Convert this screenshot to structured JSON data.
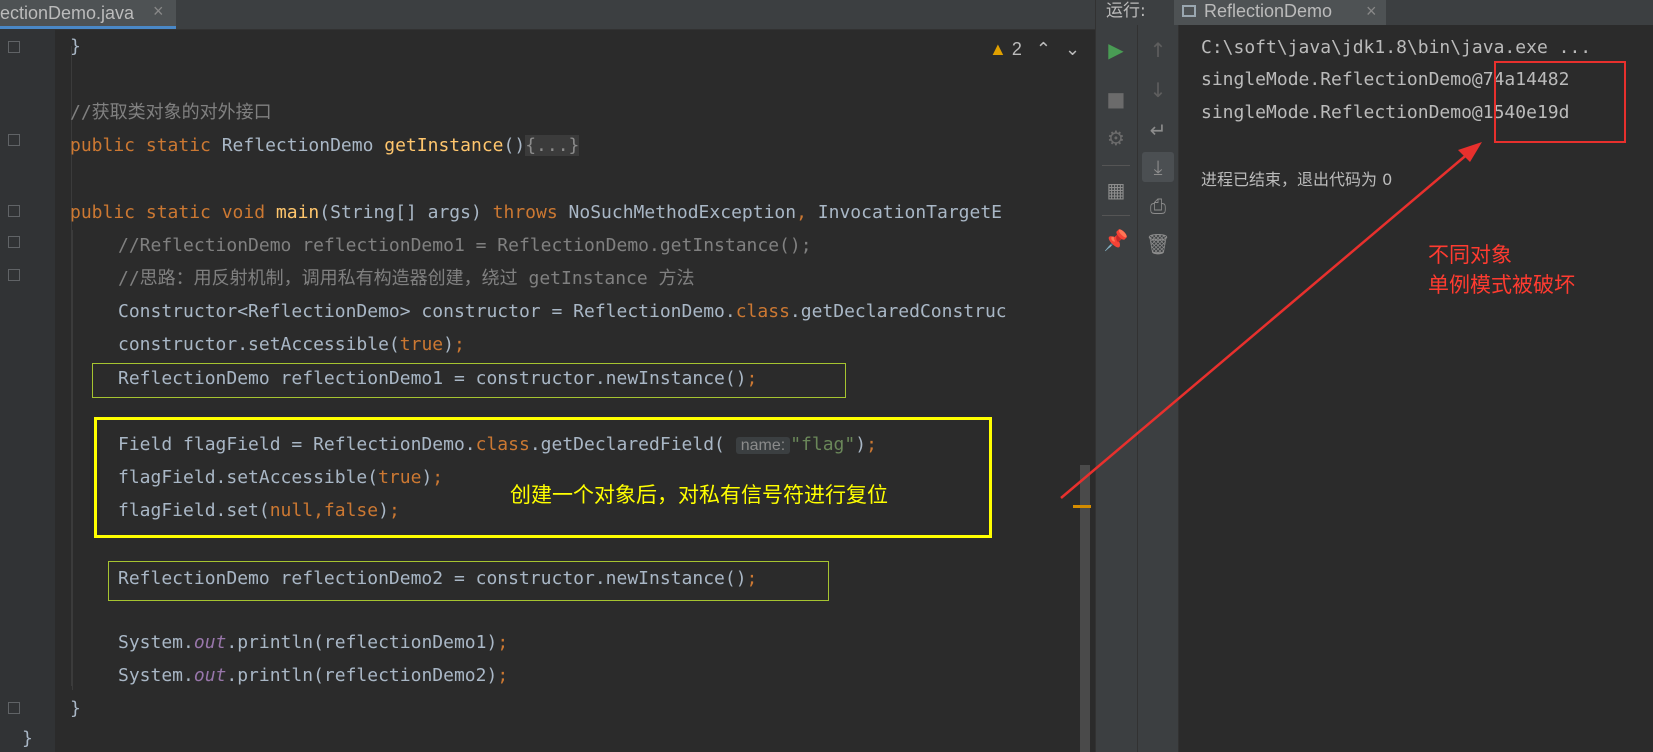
{
  "editor": {
    "tab_title": "ectionDemo.java",
    "tab_close": "×",
    "warning_count": "2",
    "lines": [
      "}",
      "//获取类对象的对外接口",
      "public static ReflectionDemo getInstance(){...}",
      "public static void main(String[] args) throws NoSuchMethodException, InvocationTargetE",
      "//ReflectionDemo reflectionDemo1 = ReflectionDemo.getInstance();",
      "//思路：用反射机制，调用私有构造器创建，绕过 getInstance 方法",
      "Constructor<ReflectionDemo> constructor = ReflectionDemo.class.getDeclaredConstruc",
      "constructor.setAccessible(true);",
      "ReflectionDemo reflectionDemo1 = constructor.newInstance();",
      "Field flagField = ReflectionDemo.class.getDeclaredField( name: \"flag\");",
      "flagField.setAccessible(true);",
      "flagField.set(null,false);",
      "ReflectionDemo reflectionDemo2 = constructor.newInstance();",
      "System.out.println(reflectionDemo1);",
      "System.out.println(reflectionDemo2);",
      "}",
      "}"
    ],
    "param_hint": "name:",
    "annotation": "创建一个对象后，对私有信号符进行复位"
  },
  "run": {
    "label": "运行:",
    "tab_title": "ReflectionDemo",
    "tab_close": "×",
    "output": [
      "C:\\soft\\java\\jdk1.8\\bin\\java.exe ...",
      "singleMode.ReflectionDemo@74a14482",
      "singleMode.ReflectionDemo@1540e19d",
      "",
      "进程已结束，退出代码为 0"
    ],
    "annotation_line1": "不同对象",
    "annotation_line2": "单例模式被破坏"
  },
  "colors": {
    "highlight_yellow": "#ffff00",
    "highlight_green": "#a6c430",
    "annotation_red": "#e8302d"
  }
}
